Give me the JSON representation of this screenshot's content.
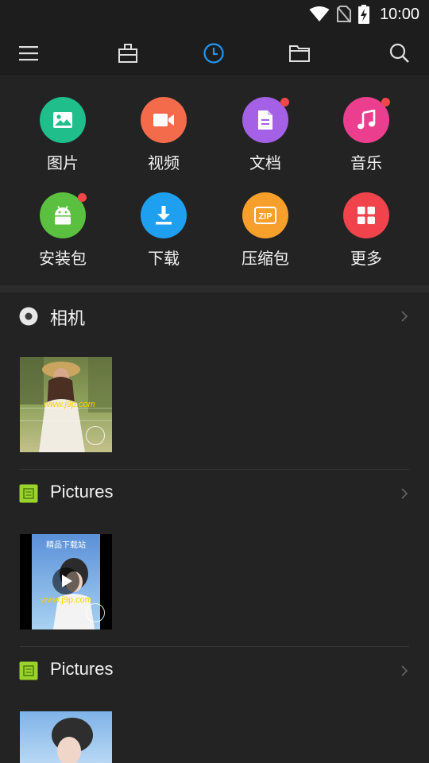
{
  "status_bar": {
    "time": "10:00",
    "icons": [
      "wifi-icon",
      "no-sim-icon",
      "battery-charging-icon"
    ]
  },
  "toolbar": {
    "items": [
      "menu-icon",
      "toolbox-icon",
      "recent-clock-icon",
      "folder-icon",
      "search-icon"
    ],
    "active": "recent-clock-icon",
    "accent_color": "#2196f3"
  },
  "categories": [
    {
      "label": "图片",
      "icon": "image-icon",
      "color": "#1fbe8a",
      "badge": false
    },
    {
      "label": "视频",
      "icon": "video-camera-icon",
      "color": "#f46b4c",
      "badge": false
    },
    {
      "label": "文档",
      "icon": "document-icon",
      "color": "#a461e6",
      "badge": true
    },
    {
      "label": "音乐",
      "icon": "music-note-icon",
      "color": "#ec3e8e",
      "badge": true
    },
    {
      "label": "安装包",
      "icon": "android-icon",
      "color": "#5bbf3f",
      "badge": true
    },
    {
      "label": "下载",
      "icon": "download-icon",
      "color": "#1f9ff0",
      "badge": false
    },
    {
      "label": "压缩包",
      "icon": "zip-icon",
      "color": "#f6a02b",
      "badge": false
    },
    {
      "label": "更多",
      "icon": "grid-more-icon",
      "color": "#f0434b",
      "badge": false
    }
  ],
  "sections": [
    {
      "title": "相机",
      "icon": "camera-lens-icon",
      "thumb": {
        "overlay_text": "www.j9p.com",
        "type": "photo"
      }
    },
    {
      "title": "Pictures",
      "icon": "pictures-folder-icon",
      "thumb": {
        "overlay_text": "精品下载站",
        "overlay_text2": "www.j9p.com",
        "type": "video"
      }
    },
    {
      "title": "Pictures",
      "icon": "pictures-folder-icon",
      "thumb": {
        "type": "photo"
      }
    }
  ]
}
